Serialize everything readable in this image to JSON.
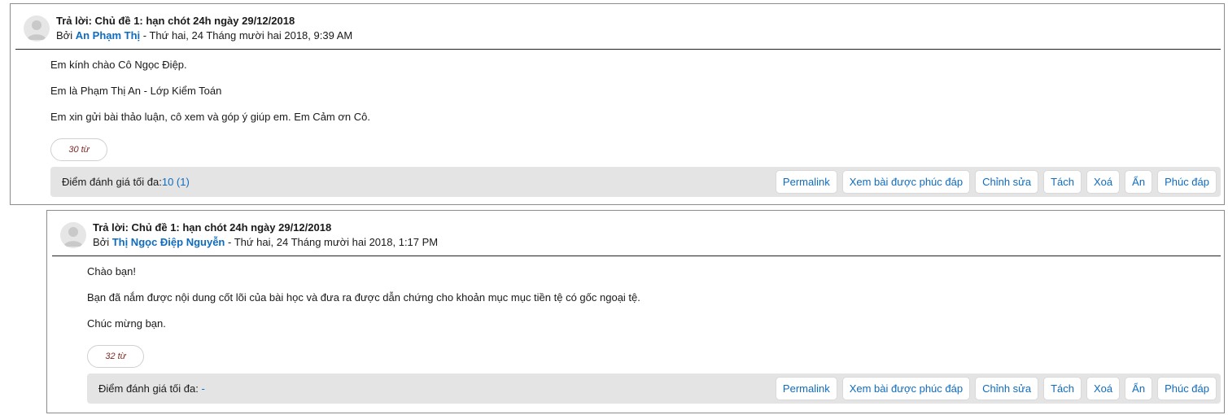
{
  "posts": [
    {
      "subject": "Trả lời: Chủ đề 1: hạn chót 24h ngày 29/12/2018",
      "by_prefix": "Bởi ",
      "author": "An Phạm Thị",
      "date": " - Thứ hai, 24 Tháng mười hai 2018, 9:39 AM",
      "paragraphs": [
        "Em kính chào Cô Ngọc Điệp.",
        "Em là Phạm Thị An - Lớp Kiểm Toán",
        "Em xin gửi bài thảo luận, cô xem và góp ý giúp em. Em Cảm ơn Cô."
      ],
      "word_count": "30 từ",
      "rating_label": "Điểm đánh giá tối đa:",
      "rating_value": "10 (1)"
    },
    {
      "subject": "Trả lời: Chủ đề 1: hạn chót 24h ngày 29/12/2018",
      "by_prefix": "Bởi ",
      "author": "Thị Ngọc Điệp Nguyễn",
      "date": " - Thứ hai, 24 Tháng mười hai 2018, 1:17 PM",
      "paragraphs": [
        "Chào bạn!",
        "Bạn đã nắm được nội dung cốt lõi của bài học và đưa ra được dẫn chứng cho khoản mục mục tiền tệ có gốc ngoại tệ.",
        "Chúc mừng bạn."
      ],
      "word_count": "32 từ",
      "rating_label": "Điểm đánh giá tối đa: ",
      "rating_value": "-"
    }
  ],
  "actions": {
    "permalink": "Permalink",
    "show_parent": "Xem bài được phúc đáp",
    "edit": "Chỉnh sửa",
    "split": "Tách",
    "delete": "Xoá",
    "hide": "Ẩn",
    "reply": "Phúc đáp"
  },
  "colors": {
    "link": "#0f6cbf",
    "footer_bg": "#e4e4e4",
    "word_count": "#7d2a24"
  }
}
